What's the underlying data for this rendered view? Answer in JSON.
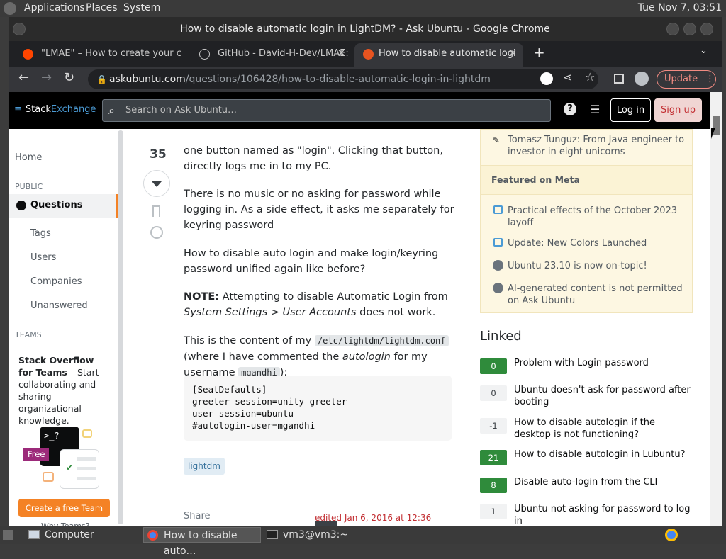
{
  "top_panel": {
    "menus": [
      "Applications",
      "Places",
      "System"
    ],
    "clock": "Tue Nov  7, 03:51"
  },
  "window": {
    "title": "How to disable automatic login in LightDM? - Ask Ubuntu - Google Chrome"
  },
  "tabs": [
    {
      "label": "\"LMAE\" – How to create your c",
      "favicon": "reddit-icon"
    },
    {
      "label": "GitHub - David-H-Dev/LMAE: C",
      "favicon": "github-icon"
    },
    {
      "label": "How to disable automatic logi",
      "favicon": "askubuntu-icon",
      "active": true
    }
  ],
  "toolbar": {
    "url_host": "askubuntu.com",
    "url_path": "/questions/106428/how-to-disable-automatic-login-in-lightdm",
    "update_label": "Update"
  },
  "se_header": {
    "logo_stack": "Stack",
    "logo_exchange": "Exchange",
    "search_placeholder": "Search on Ask Ubuntu…",
    "login_label": "Log in",
    "signup_label": "Sign up"
  },
  "leftnav": {
    "home": "Home",
    "public": "PUBLIC",
    "questions": "Questions",
    "tags": "Tags",
    "users": "Users",
    "companies": "Companies",
    "unanswered": "Unanswered",
    "teams": "TEAMS",
    "teams_promo_bold": "Stack Overflow for Teams",
    "teams_promo_rest": " – Start collaborating and sharing organizational knowledge.",
    "free_badge": "Free",
    "create_team_btn": "Create a free Team",
    "why_teams": "Why Teams?"
  },
  "question": {
    "score": "35",
    "p0": "one button named as \"login\". Clicking that button, directly logs me in to my PC.",
    "p1": "There is no music or no asking for password while logging in. As a side effect, it asks me separately for keyring password",
    "p2": "How to disable auto login and make login/keyring password unified again like before?",
    "p3_bold": "NOTE:",
    "p3_a": " Attempting to disable Automatic Login from ",
    "p3_italic": "System Settings > User Accounts",
    "p3_b": " does not work.",
    "p4_a": "This is the content of my ",
    "p4_code": "/etc/lightdm/lightdm.conf",
    "p4_b": " (where I have commented the ",
    "p4_italic": "autologin",
    "p4_c": " for my username ",
    "p4_code2": "mgandhi",
    "p4_d": "):",
    "code": "[SeatDefaults]\ngreeter-session=unity-greeter\nuser-session=ubuntu\n#autologin-user=mgandhi",
    "tag": "lightdm",
    "share": "Share",
    "edited": "edited Jan 6, 2016 at 12:36"
  },
  "sidebar": {
    "blog_item": "Tomasz Tunguz: From Java engineer to investor in eight unicorns",
    "meta_heading": "Featured on Meta",
    "meta_items": [
      {
        "text": "Practical effects of the October 2023 layoff",
        "icon": "speech-bubble-icon"
      },
      {
        "text": "Update: New Colors Launched",
        "icon": "speech-bubble-icon"
      },
      {
        "text": "Ubuntu 23.10 is now on-topic!",
        "icon": "askubuntu-icon"
      },
      {
        "text": "AI-generated content is not permitted on Ask Ubuntu",
        "icon": "askubuntu-icon"
      }
    ],
    "linked_title": "Linked",
    "linked": [
      {
        "score": "0",
        "title": "Problem with Login password",
        "accepted": true
      },
      {
        "score": "0",
        "title": "Ubuntu doesn't ask for password after booting",
        "accepted": false
      },
      {
        "score": "-1",
        "title": "How to disable autologin if the desktop is not functioning?",
        "accepted": false
      },
      {
        "score": "21",
        "title": "How to disable autologin in Lubuntu?",
        "accepted": true
      },
      {
        "score": "8",
        "title": "Disable auto-login from the CLI",
        "accepted": true
      },
      {
        "score": "1",
        "title": "Ubuntu not asking for password to log in",
        "accepted": false
      }
    ]
  },
  "taskbar": {
    "computer": "Computer",
    "chrome_task": "How to disable auto…",
    "terminal_task": "vm3@vm3:~"
  },
  "colors": {
    "accent_orange": "#f48225",
    "accepted_green": "#2f8b3b",
    "link_blue": "#39739d"
  }
}
